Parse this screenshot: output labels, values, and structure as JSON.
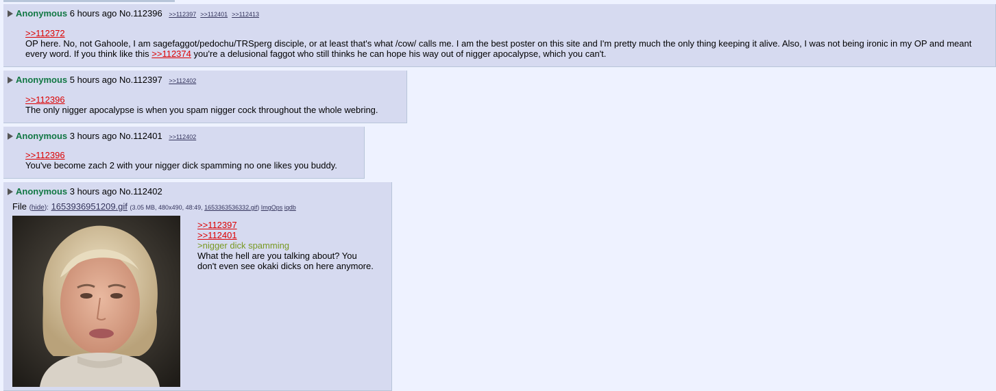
{
  "posts": [
    {
      "name": "Anonymous",
      "time": "6 hours ago",
      "number": "No.112396",
      "backlinks": [
        ">>112397",
        ">>112401",
        ">>112413"
      ],
      "quote": ">>112372",
      "body_part1": "OP here. No, not Gahoole, I am sagefaggot/pedochu/TRSperg disciple, or at least that's what /cow/ calls me. I am the best poster on this site and I'm pretty much the only thing keeping it alive. Also, I was not being ironic in my OP and meant every word. If you think like this",
      "inline_quote": ">>112374",
      "body_part2": "you're a delusional faggot who still thinks he can hope his way out of nigger apocalypse, which you can't."
    },
    {
      "name": "Anonymous",
      "time": "5 hours ago",
      "number": "No.112397",
      "backlinks": [
        ">>112402"
      ],
      "quote": ">>112396",
      "body": "The only nigger apocalypse is when you spam nigger cock throughout the whole webring."
    },
    {
      "name": "Anonymous",
      "time": "3 hours ago",
      "number": "No.112401",
      "backlinks": [
        ">>112402"
      ],
      "quote": ">>112396",
      "body": "You've become zach 2 with your nigger dick spamming no one likes you buddy."
    },
    {
      "name": "Anonymous",
      "time": "3 hours ago",
      "number": "No.112402",
      "file": {
        "label": "File",
        "hide": "hide",
        "filename": "1653936951209.gif",
        "meta_size": "(3.05 MB, 480x490, 48:49,",
        "orig_name": "1653363536332.gif",
        "meta_close": ")",
        "imgops": "ImgOps",
        "iqdb": "iqdb"
      },
      "quotes": [
        ">>112397",
        ">>112401"
      ],
      "greentext": ">nigger dick spamming",
      "body": "What the hell are you talking about? You don't even see okaki dicks on here anymore."
    }
  ]
}
